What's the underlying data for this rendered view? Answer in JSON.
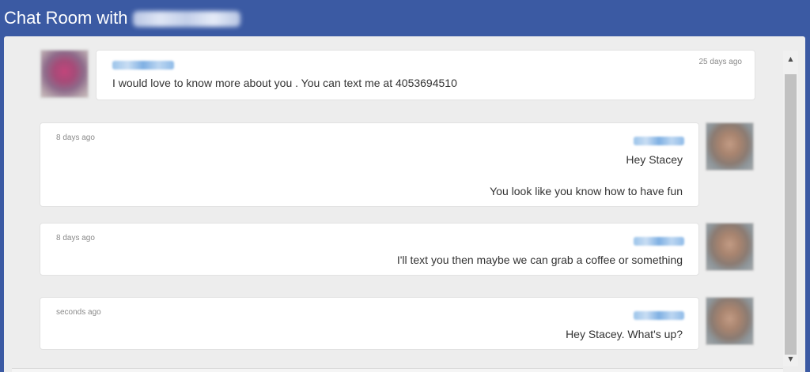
{
  "header": {
    "title": "Chat Room with"
  },
  "messages": [
    {
      "side": "left",
      "time": "25 days ago",
      "lines": [
        "I would love to know more about you . You can text me at 4053694510"
      ]
    },
    {
      "side": "right",
      "time": "8 days ago",
      "lines": [
        "Hey Stacey",
        "You look like you know how to have fun"
      ]
    },
    {
      "side": "right",
      "time": "8 days ago",
      "lines": [
        "I'll text you then maybe we can grab a coffee or something"
      ]
    },
    {
      "side": "right",
      "time": "seconds ago",
      "lines": [
        "Hey Stacey. What's up?"
      ]
    }
  ],
  "icons": {
    "scroll_up": "scroll-up-arrow-icon",
    "scroll_down": "scroll-down-arrow-icon"
  },
  "colors": {
    "header_bg": "#3b5aa3",
    "panel_bg": "#ededed",
    "bubble_bg": "#ffffff",
    "text": "#333333",
    "timestamp": "#8a8a8a"
  }
}
